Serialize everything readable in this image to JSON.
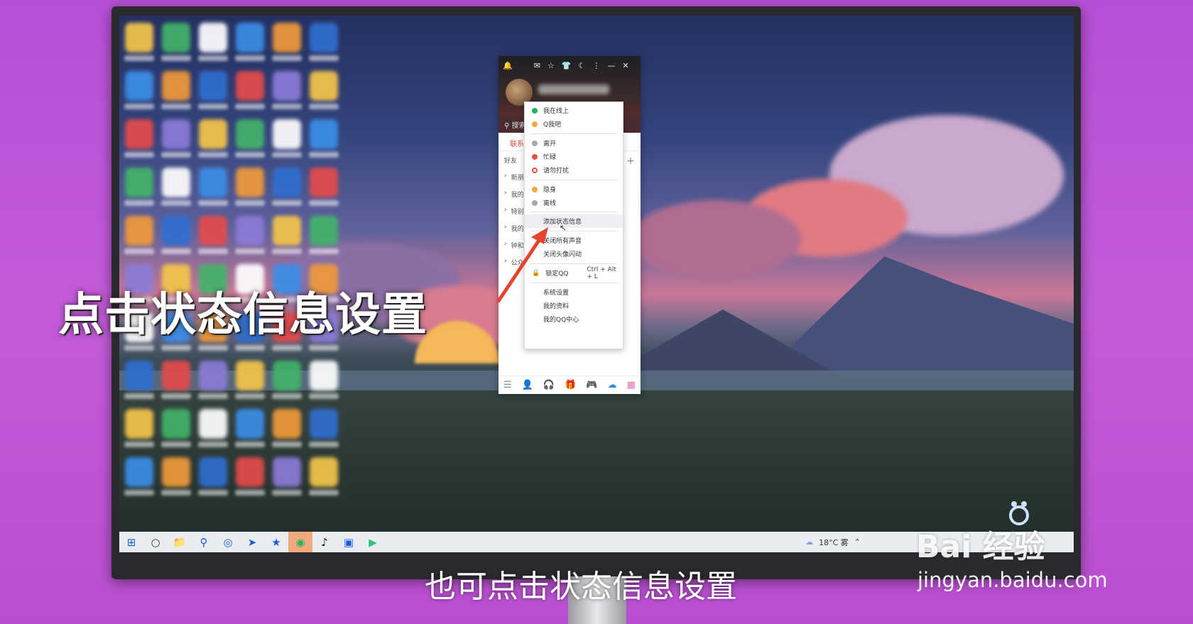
{
  "qq_context_menu": {
    "items": [
      {
        "label": "我在线上",
        "dot_color": "#21b35c"
      },
      {
        "label": "Q我吧",
        "dot_color": "#f2a83a"
      },
      {
        "label": "离开",
        "dot_color": "#a7a7a7"
      },
      {
        "label": "忙碌",
        "dot_color": "#e6513e"
      },
      {
        "label": "请勿打扰",
        "dot_color": "#e6513e"
      },
      {
        "label": "隐身",
        "dot_color": "#f2a83a"
      },
      {
        "label": "离线",
        "dot_color": "#a7a7a7"
      },
      {
        "label": "添加状态信息"
      },
      {
        "label": "关闭所有声音"
      },
      {
        "label": "关闭头像闪动"
      },
      {
        "label": "锁定QQ",
        "shortcut": "Ctrl + Alt + L"
      },
      {
        "label": "系统设置"
      },
      {
        "label": "我的资料"
      },
      {
        "label": "我的QQ中心"
      }
    ]
  },
  "qq_panel": {
    "search_label": "搜索",
    "tab_label": "联系",
    "list_rows": [
      "好友",
      "新朋",
      "我的",
      "特别",
      "我的",
      "钟和",
      "公众"
    ]
  },
  "taskbar": {
    "weather": "18°C 雾"
  },
  "captions": {
    "left": "点击状态信息设置",
    "bottom": "也可点击状态信息设置"
  },
  "watermark": {
    "logo_text": "Bai  经验",
    "url": "jingyan.baidu.com"
  }
}
